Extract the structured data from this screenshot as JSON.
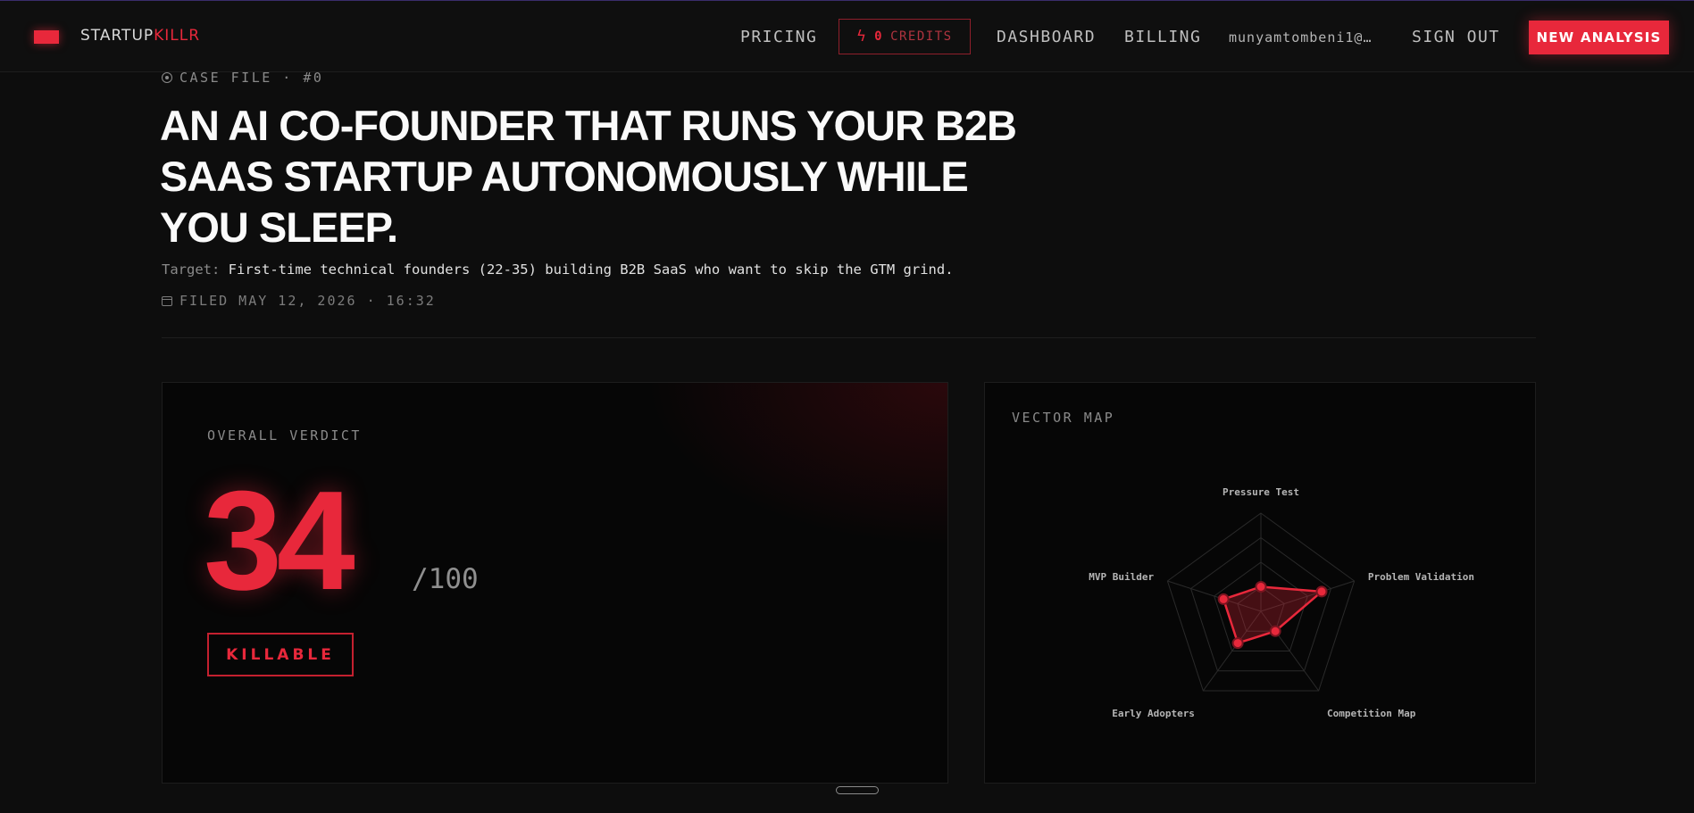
{
  "nav": {
    "brand_prefix": "STARTUP",
    "brand_suffix": "KILLR",
    "pricing": "PRICING",
    "credits_count": "0",
    "credits_label": "CREDITS",
    "dashboard": "DASHBOARD",
    "billing": "BILLING",
    "user_email": "munyamtombeni1@…",
    "sign_out": "SIGN OUT",
    "new_analysis": "NEW ANALYSIS"
  },
  "case": {
    "case_file": "CASE FILE · #0",
    "title": "AN AI CO-FOUNDER THAT RUNS YOUR B2B SAAS STARTUP AUTONOMOUSLY WHILE YOU SLEEP.",
    "target_key": "Target:",
    "target_value": "First-time technical founders (22-35) building B2B SaaS who want to skip the GTM grind.",
    "filed": "FILED MAY 12, 2026 · 16:32"
  },
  "verdict": {
    "label": "OVERALL VERDICT",
    "score": "34",
    "max": "/100",
    "badge": "KILLABLE"
  },
  "vector_map": {
    "label": "VECTOR MAP"
  },
  "chart_data": {
    "type": "radar",
    "categories": [
      "Pressure Test",
      "Problem Validation",
      "Competition Map",
      "Early Adopters",
      "MVP Builder"
    ],
    "values": [
      25,
      65,
      25,
      40,
      40
    ],
    "rlim": [
      0,
      100
    ],
    "rings": 4,
    "color": "#e8283b"
  },
  "colors": {
    "accent": "#e8283b",
    "background": "#0d0d0d"
  }
}
